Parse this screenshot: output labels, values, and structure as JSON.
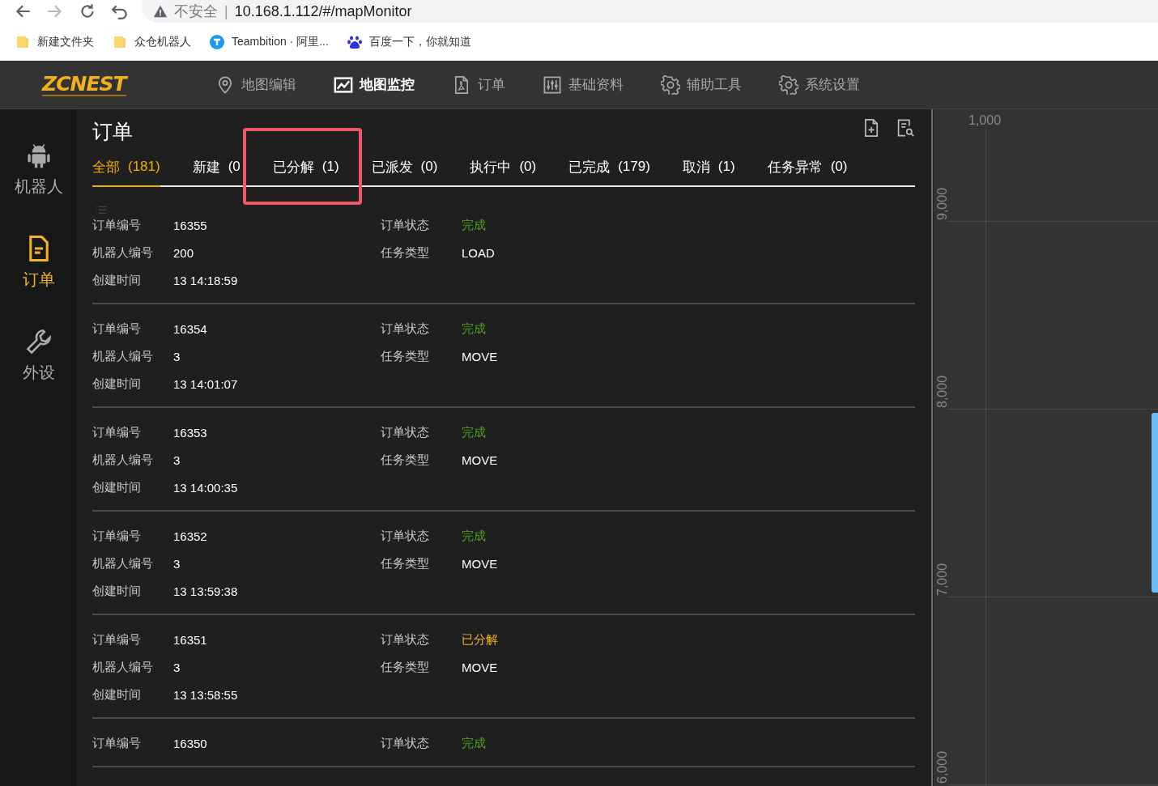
{
  "browser": {
    "security_label": "不安全",
    "separator": "|",
    "url": "10.168.1.112/#/mapMonitor",
    "bookmarks": [
      {
        "label": "新建文件夹"
      },
      {
        "label": "众仓机器人"
      },
      {
        "label": "Teambition · 阿里..."
      },
      {
        "label": "百度一下，你就知道"
      }
    ]
  },
  "header": {
    "logo": "ZCNEST",
    "nav": [
      {
        "label": "地图编辑",
        "selected": false
      },
      {
        "label": "地图监控",
        "selected": true
      },
      {
        "label": "订单",
        "selected": false
      },
      {
        "label": "基础资料",
        "selected": false
      },
      {
        "label": "辅助工具",
        "selected": false
      },
      {
        "label": "系统设置",
        "selected": false
      }
    ]
  },
  "sidebar": {
    "items": [
      {
        "label": "机器人",
        "selected": false
      },
      {
        "label": "订单",
        "selected": true
      },
      {
        "label": "外设",
        "selected": false
      }
    ]
  },
  "orders": {
    "title": "订单",
    "tabs": [
      {
        "label": "全部",
        "count": "(181)",
        "selected": true,
        "highlighted": false
      },
      {
        "label": "新建",
        "count": "(0",
        "selected": false,
        "highlighted": false
      },
      {
        "label": "已分解",
        "count": "(1)",
        "selected": false,
        "highlighted": true
      },
      {
        "label": "已派发",
        "count": "(0)",
        "selected": false,
        "highlighted": false
      },
      {
        "label": "执行中",
        "count": "(0)",
        "selected": false,
        "highlighted": false
      },
      {
        "label": "已完成",
        "count": "(179)",
        "selected": false,
        "highlighted": false
      },
      {
        "label": "取消",
        "count": "(1)",
        "selected": false,
        "highlighted": false
      },
      {
        "label": "任务异常",
        "count": "(0)",
        "selected": false,
        "highlighted": false
      }
    ],
    "cards": [
      {
        "fields": [
          {
            "label": "订单编号",
            "value": "16355"
          },
          {
            "label": "机器人编号",
            "value": "200"
          },
          {
            "label": "创建时间",
            "value": "13 14:18:59"
          }
        ],
        "status": {
          "label": "订单状态",
          "value": "完成",
          "color": "#52a41c"
        },
        "task": {
          "label": "任务类型",
          "value": "LOAD"
        }
      },
      {
        "fields": [
          {
            "label": "订单编号",
            "value": "16354"
          },
          {
            "label": "机器人编号",
            "value": "3"
          },
          {
            "label": "创建时间",
            "value": "13 14:01:07"
          }
        ],
        "status": {
          "label": "订单状态",
          "value": "完成",
          "color": "#52a41c"
        },
        "task": {
          "label": "任务类型",
          "value": "MOVE"
        }
      },
      {
        "fields": [
          {
            "label": "订单编号",
            "value": "16353"
          },
          {
            "label": "机器人编号",
            "value": "3"
          },
          {
            "label": "创建时间",
            "value": "13 14:00:35"
          }
        ],
        "status": {
          "label": "订单状态",
          "value": "完成",
          "color": "#52a41c"
        },
        "task": {
          "label": "任务类型",
          "value": "MOVE"
        }
      },
      {
        "fields": [
          {
            "label": "订单编号",
            "value": "16352"
          },
          {
            "label": "机器人编号",
            "value": "3"
          },
          {
            "label": "创建时间",
            "value": "13 13:59:38"
          }
        ],
        "status": {
          "label": "订单状态",
          "value": "完成",
          "color": "#52a41c"
        },
        "task": {
          "label": "任务类型",
          "value": "MOVE"
        }
      },
      {
        "fields": [
          {
            "label": "订单编号",
            "value": "16351"
          },
          {
            "label": "机器人编号",
            "value": "3"
          },
          {
            "label": "创建时间",
            "value": "13 13:58:55"
          }
        ],
        "status": {
          "label": "订单状态",
          "value": "已分解",
          "color": "#f5b126"
        },
        "task": {
          "label": "任务类型",
          "value": "MOVE"
        }
      },
      {
        "fields": [
          {
            "label": "订单编号",
            "value": "16350"
          }
        ],
        "status": {
          "label": "订单状态",
          "value": "完成",
          "color": "#52a41c"
        }
      }
    ]
  },
  "map": {
    "x_labels": [
      "1,000"
    ],
    "y_labels": [
      "9,000",
      "8,000",
      "7,000",
      "6,000"
    ]
  }
}
